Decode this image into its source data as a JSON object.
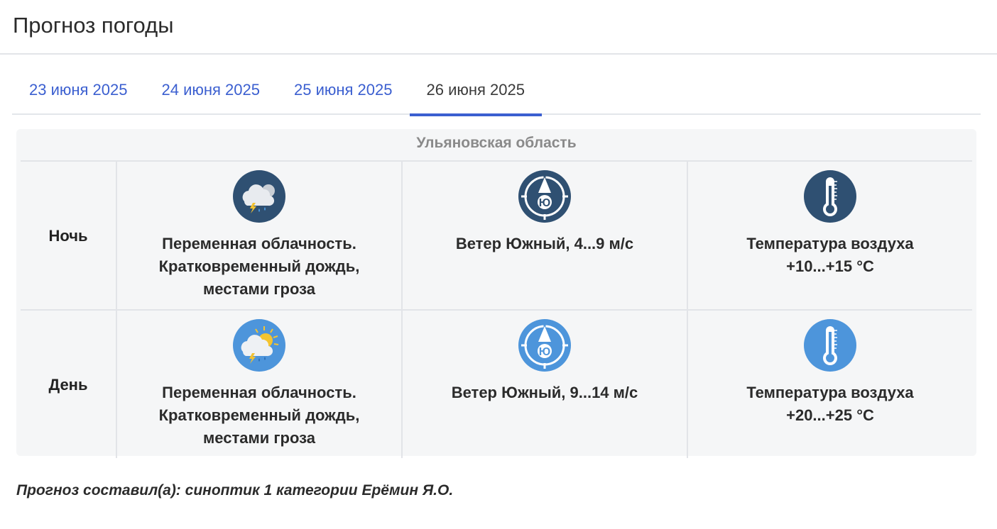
{
  "page": {
    "title": "Прогноз погоды"
  },
  "tabs": [
    {
      "label": "23 июня 2025",
      "active": false
    },
    {
      "label": "24 июня 2025",
      "active": false
    },
    {
      "label": "25 июня 2025",
      "active": false
    },
    {
      "label": "26 июня 2025",
      "active": true
    }
  ],
  "forecast": {
    "region": "Ульяновская область",
    "rows": [
      {
        "period": "Ночь",
        "sky": {
          "icon": "night-cloud-rain-thunder-icon",
          "lines": [
            "Переменная облачность.",
            "Кратковременный дождь,",
            "местами гроза"
          ]
        },
        "wind": {
          "icon": "wind-compass-south-icon",
          "direction_letter": "Ю",
          "text": "Ветер Южный, 4...9 м/с"
        },
        "temperature": {
          "icon": "thermometer-icon",
          "lines": [
            "Температура воздуха",
            "+10...+15 °С"
          ]
        }
      },
      {
        "period": "День",
        "sky": {
          "icon": "day-sun-cloud-rain-thunder-icon",
          "lines": [
            "Переменная облачность.",
            "Кратковременный дождь,",
            "местами гроза"
          ]
        },
        "wind": {
          "icon": "wind-compass-south-icon",
          "direction_letter": "Ю",
          "text": "Ветер Южный, 9...14 м/с"
        },
        "temperature": {
          "icon": "thermometer-icon",
          "lines": [
            "Температура воздуха",
            "+20...+25 °С"
          ]
        }
      }
    ]
  },
  "footer": {
    "text": "Прогноз составил(а): синоптик 1 категории Ерёмин Я.О."
  },
  "colors": {
    "accent": "#3b5fd0",
    "night_icon_bg": "#2f5072",
    "day_icon_bg": "#4d95db",
    "panel_bg": "#f5f6f7"
  }
}
